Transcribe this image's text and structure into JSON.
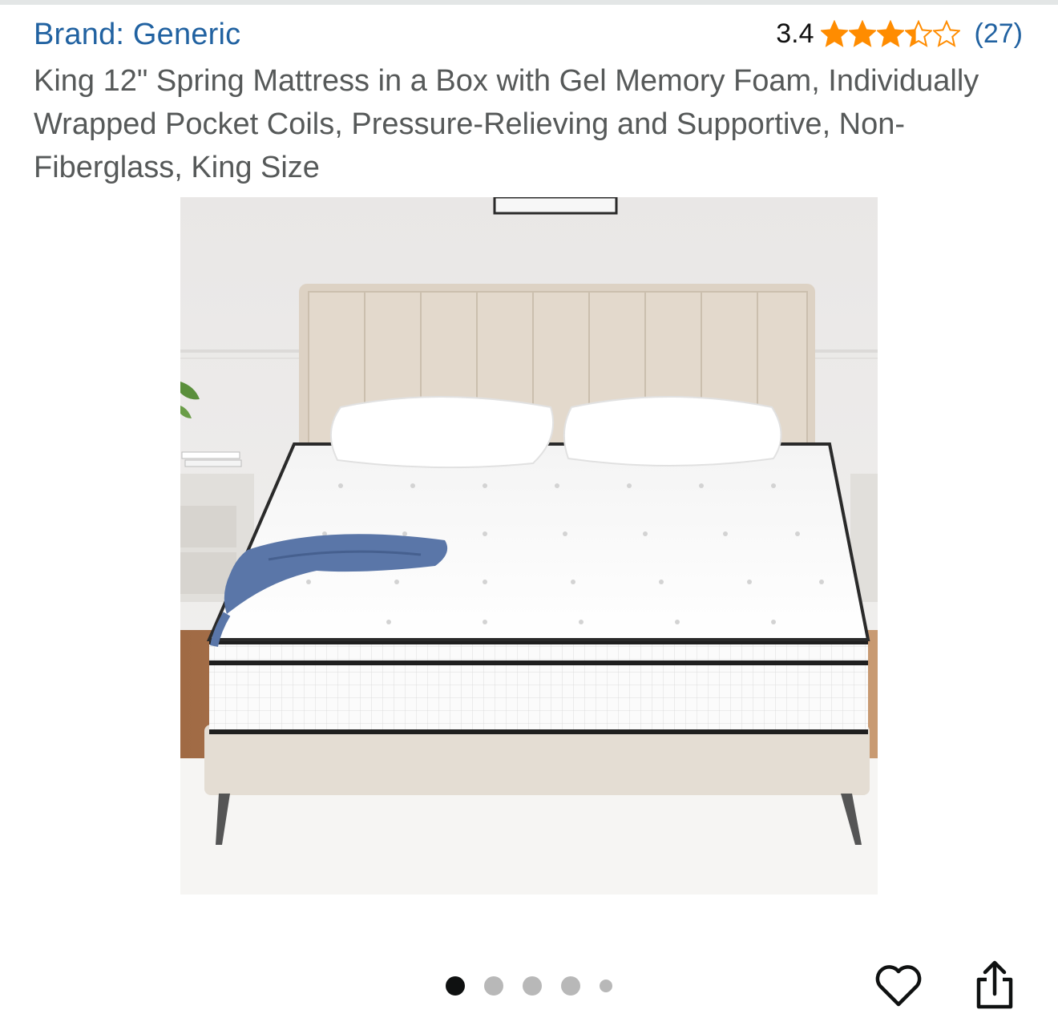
{
  "product": {
    "brand_label": "Brand: Generic",
    "rating_value": "3.4",
    "rating_stars": 3.4,
    "rating_count": "(27)",
    "title": "King 12\" Spring Mattress in a Box with Gel Memory Foam, Individually Wrapped Pocket Coils, Pressure-Relieving and Supportive, Non-Fiberglass, King Size"
  },
  "gallery": {
    "image_subject": "mattress-on-upholstered-bed",
    "total_images": 5,
    "active_index": 0
  },
  "actions": {
    "favorite_icon": "heart-icon",
    "share_icon": "share-icon"
  },
  "colors": {
    "link": "#2162a1",
    "star": "#ff8c00",
    "title": "#565959"
  }
}
